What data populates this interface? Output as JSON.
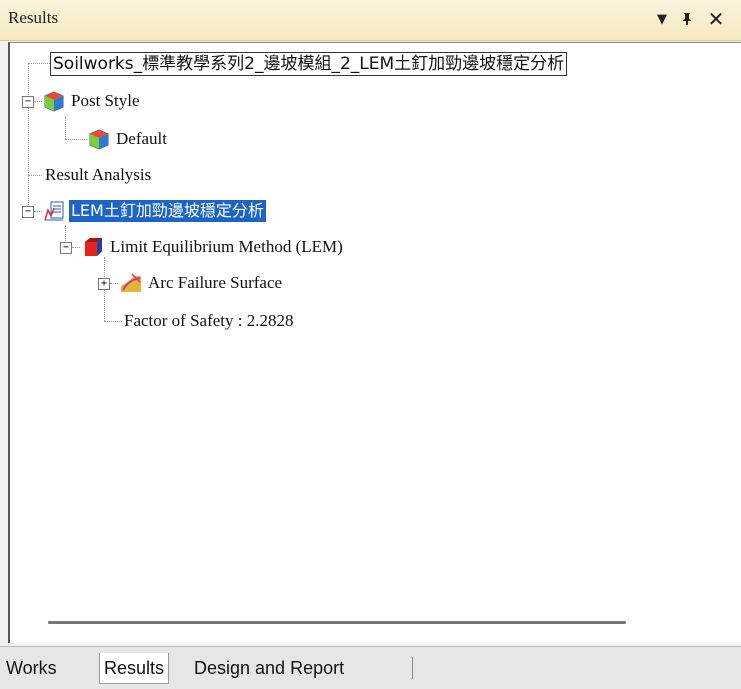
{
  "window": {
    "title": "Results",
    "buttons": {
      "dropdown": "▼",
      "pin": "ᵖ",
      "close": "✕"
    }
  },
  "tree": {
    "model_label": "Soilworks_標準教學系列2_邊坡模組_2_LEM土釘加勁邊坡穩定分析",
    "post_style": {
      "label": "Post Style",
      "expander": "−",
      "children": [
        {
          "label": "Default"
        }
      ]
    },
    "result_analysis": {
      "label": "Result Analysis"
    },
    "analysis": {
      "label": "LEM土釘加勁邊坡穩定分析",
      "expander": "−",
      "method": {
        "label": "Limit Equilibrium Method (LEM)",
        "expander": "−",
        "arc": {
          "label": "Arc Failure Surface",
          "expander": "+"
        },
        "factor_of_safety": "Factor of Safety : 2.2828"
      }
    }
  },
  "tabs": [
    {
      "label": "Works",
      "active": false
    },
    {
      "label": "Results",
      "active": true
    },
    {
      "label": "Design and Report",
      "active": false
    }
  ],
  "colors": {
    "selection": "#1c64c8",
    "titlebar": "#f6e9c1"
  },
  "icons": {
    "post_style": "cube-color-icon",
    "default": "cube-color-icon",
    "analysis": "chart-document-icon",
    "method": "red-cube-icon",
    "arc": "arc-surface-icon"
  }
}
